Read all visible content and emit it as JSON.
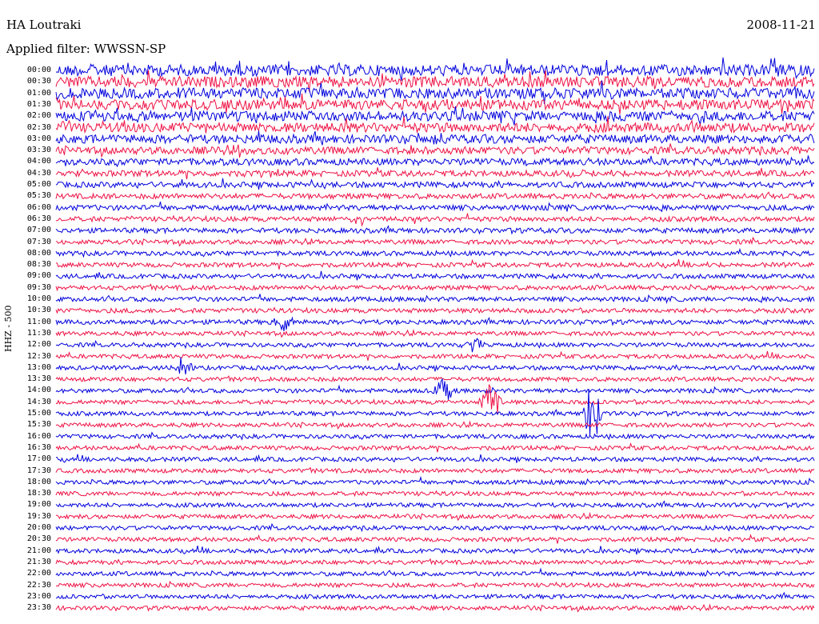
{
  "header": {
    "station": "HA Loutraki",
    "date": "2008-11-21",
    "filter": "Applied filter: WWSSN-SP"
  },
  "channel_label": "HHZ - 500",
  "chart_data": {
    "type": "line",
    "title": "HA Loutraki",
    "subtitle": "Applied filter: WWSSN-SP",
    "ylabel": "HHZ - 500",
    "xlabel": "",
    "row_labels": [
      "00:00",
      "00:30",
      "01:00",
      "01:30",
      "02:00",
      "02:30",
      "03:00",
      "03:30",
      "04:00",
      "04:30",
      "05:00",
      "05:30",
      "06:00",
      "06:30",
      "07:00",
      "07:30",
      "08:00",
      "08:30",
      "09:00",
      "09:30",
      "10:00",
      "10:30",
      "11:00",
      "11:30",
      "12:00",
      "12:30",
      "13:00",
      "13:30",
      "14:00",
      "14:30",
      "15:00",
      "15:30",
      "16:00",
      "16:30",
      "17:00",
      "17:30",
      "18:00",
      "18:30",
      "19:00",
      "19:30",
      "20:00",
      "20:30",
      "21:00",
      "21:30",
      "22:00",
      "22:30",
      "23:00",
      "23:30"
    ],
    "colors": [
      "#0000dd",
      "#ee1144"
    ],
    "minutes_per_row": 30,
    "noise_level": [
      3.2,
      3.1,
      3.0,
      2.9,
      2.8,
      2.7,
      2.4,
      2.1,
      1.9,
      1.7,
      1.6,
      1.5,
      1.5,
      1.4,
      1.4,
      1.3,
      1.3,
      1.3,
      1.3,
      1.3,
      1.3,
      1.3,
      1.3,
      1.2,
      1.2,
      1.2,
      1.2,
      1.2,
      1.2,
      1.2,
      1.2,
      1.2,
      1.2,
      1.2,
      1.2,
      1.2,
      1.2,
      1.2,
      1.2,
      1.2,
      1.2,
      1.2,
      1.2,
      1.2,
      1.2,
      1.2,
      1.2,
      1.2
    ],
    "events": [
      {
        "row": 28,
        "minute": 15.3,
        "amplitude": 2.5
      },
      {
        "row": 29,
        "minute": 17.2,
        "amplitude": 5
      },
      {
        "row": 30,
        "minute": 21.2,
        "amplitude": 6
      },
      {
        "row": 26,
        "minute": 5.0,
        "amplitude": 1.8
      },
      {
        "row": 22,
        "minute": 9.0,
        "amplitude": 1.8
      },
      {
        "row": 24,
        "minute": 16.5,
        "amplitude": 1.6
      },
      {
        "row": 13,
        "minute": 12.0,
        "amplitude": 1.3
      }
    ]
  }
}
